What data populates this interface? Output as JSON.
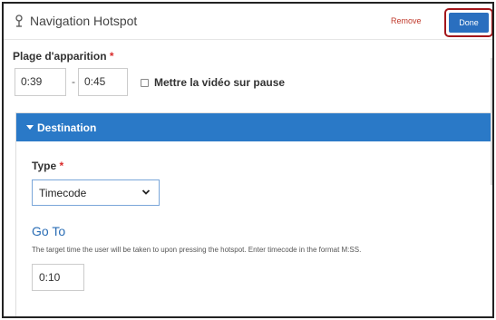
{
  "header": {
    "icon": "hotspot-pin-icon",
    "title": "Navigation Hotspot",
    "remove_label": "Remove",
    "done_label": "Done"
  },
  "plage": {
    "label": "Plage d'apparition",
    "required_mark": "*",
    "start_time": "0:39",
    "separator": "-",
    "end_time": "0:45",
    "pause_label": "Mettre la vidéo sur pause",
    "pause_checked": false
  },
  "destination": {
    "title": "Destination",
    "caret_icon": "caret-down-icon",
    "type_label": "Type",
    "required_mark": "*",
    "type_value": "Timecode",
    "goto_title": "Go To",
    "goto_description": "The target time the user will be taken to upon pressing the hotspot. Enter timecode in the format M:SS.",
    "goto_value": "0:10"
  },
  "colors": {
    "accent_blue": "#2a79c7",
    "done_button": "#2a6fbf",
    "highlight_border": "#a3161b",
    "required": "#d92b2b",
    "remove_link": "#c0392b"
  }
}
